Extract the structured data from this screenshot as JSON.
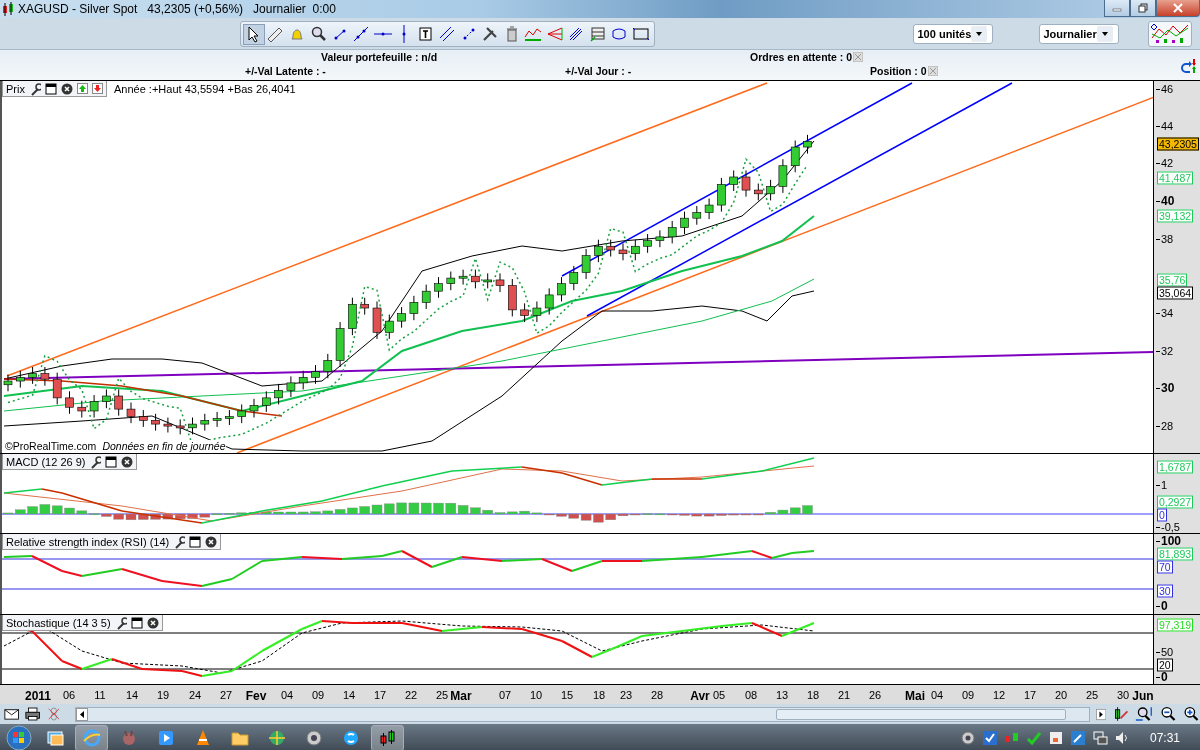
{
  "window": {
    "title": "XAGUSD - Silver Spot   43,2305 (+0,56%)   Journalier  0:00"
  },
  "toolbar": {
    "tools": [
      {
        "selected": true
      },
      {
        "selected": false
      },
      {
        "selected": false
      },
      {
        "selected": false
      },
      {
        "selected": false
      },
      {
        "selected": false
      },
      {
        "selected": false
      },
      {
        "selected": false
      },
      {
        "selected": false
      },
      {
        "selected": false
      },
      {
        "selected": false
      },
      {
        "selected": false
      },
      {
        "selected": false
      },
      {
        "selected": false
      },
      {
        "selected": false
      },
      {
        "selected": false
      },
      {
        "selected": false
      },
      {
        "selected": false
      },
      {
        "selected": false
      }
    ],
    "quantity": "100 unités",
    "timeframe": "Journalier"
  },
  "portfolio": {
    "value": "Valeur portefeuille : n/d",
    "pending_orders": "Ordres en attente : 0",
    "latent": "+/-Val Latente : -",
    "day": "+/-Val Jour : -",
    "position": "Position : 0"
  },
  "panels": [
    {
      "kind": "price",
      "title": "Prix",
      "info": "Année :+Haut 43,5594 +Bas 26,4041",
      "credit": "©ProRealTime.com",
      "note": "Données en fin de journée",
      "ticks": [
        {
          "label": "46",
          "major": false
        },
        {
          "label": "44",
          "major": false
        },
        {
          "label": "42",
          "major": false
        },
        {
          "label": "40",
          "major": true
        },
        {
          "label": "38",
          "major": false
        },
        {
          "label": "34",
          "major": false
        },
        {
          "label": "32",
          "major": false
        },
        {
          "label": "30",
          "major": true
        },
        {
          "label": "28",
          "major": false
        }
      ],
      "readings": [
        {
          "text": "43,2305",
          "color": "#f5b800",
          "filled": true
        },
        {
          "text": "41,487",
          "color": "#1ec95a",
          "filled": false
        },
        {
          "text": "39,132",
          "color": "#1ec95a",
          "filled": false
        },
        {
          "text": "35,76",
          "color": "#1ec95a",
          "filled": false
        },
        {
          "text": "35,064",
          "color": "#000000",
          "filled": false
        }
      ]
    },
    {
      "kind": "macd",
      "title": "MACD (12 26 9)",
      "ticks": [
        {
          "label": "1",
          "major": false
        },
        {
          "label": "-0,5",
          "major": false
        }
      ],
      "readings": [
        {
          "text": "1,6787",
          "color": "#1ec95a",
          "filled": false
        },
        {
          "text": "0,2927",
          "color": "#1ec95a",
          "filled": false
        },
        {
          "text": "0",
          "color": "#3030e0",
          "filled": false
        }
      ]
    },
    {
      "kind": "rsi",
      "title": "Relative strength index (RSI) (14)",
      "ticks": [
        {
          "label": "100",
          "major": true
        },
        {
          "label": "0",
          "major": true
        }
      ],
      "readings": [
        {
          "text": "81,893",
          "color": "#1ec95a",
          "filled": false
        },
        {
          "text": "70",
          "color": "#3030e0",
          "filled": false
        },
        {
          "text": "30",
          "color": "#3030e0",
          "filled": false
        }
      ]
    },
    {
      "kind": "stochastic",
      "title": "Stochastique (14 3 5)",
      "ticks": [
        {
          "label": "50",
          "major": false
        },
        {
          "label": "0",
          "major": true
        }
      ],
      "readings": [
        {
          "text": "97,319",
          "color": "#22dd22",
          "filled": false
        },
        {
          "text": "20",
          "color": "#000000",
          "filled": false
        }
      ]
    }
  ],
  "x_axis": [
    {
      "label": "2011",
      "major": true
    },
    {
      "label": "06",
      "major": false
    },
    {
      "label": "11",
      "major": false
    },
    {
      "label": "14",
      "major": false
    },
    {
      "label": "19",
      "major": false
    },
    {
      "label": "24",
      "major": false
    },
    {
      "label": "27",
      "major": false
    },
    {
      "label": "Fev",
      "major": true
    },
    {
      "label": "04",
      "major": false
    },
    {
      "label": "09",
      "major": false
    },
    {
      "label": "14",
      "major": false
    },
    {
      "label": "17",
      "major": false
    },
    {
      "label": "22",
      "major": false
    },
    {
      "label": "25",
      "major": false
    },
    {
      "label": "Mar",
      "major": true
    },
    {
      "label": "07",
      "major": false
    },
    {
      "label": "10",
      "major": false
    },
    {
      "label": "15",
      "major": false
    },
    {
      "label": "18",
      "major": false
    },
    {
      "label": "23",
      "major": false
    },
    {
      "label": "28",
      "major": false
    },
    {
      "label": "Avr",
      "major": true
    },
    {
      "label": "05",
      "major": false
    },
    {
      "label": "08",
      "major": false
    },
    {
      "label": "13",
      "major": false
    },
    {
      "label": "18",
      "major": false
    },
    {
      "label": "21",
      "major": false
    },
    {
      "label": "26",
      "major": false
    },
    {
      "label": "Mai",
      "major": true
    },
    {
      "label": "04",
      "major": false
    },
    {
      "label": "09",
      "major": false
    },
    {
      "label": "12",
      "major": false
    },
    {
      "label": "17",
      "major": false
    },
    {
      "label": "20",
      "major": false
    },
    {
      "label": "25",
      "major": false
    },
    {
      "label": "30",
      "major": false
    },
    {
      "label": "Jun",
      "major": true
    }
  ],
  "taskbar": {
    "apps": [
      {
        "selected": false
      },
      {
        "selected": true
      },
      {
        "selected": false
      },
      {
        "selected": false
      },
      {
        "selected": false
      },
      {
        "selected": false
      },
      {
        "selected": false
      },
      {
        "selected": false
      },
      {
        "selected": false
      },
      {
        "selected": true
      }
    ],
    "clock": "07:31"
  }
}
